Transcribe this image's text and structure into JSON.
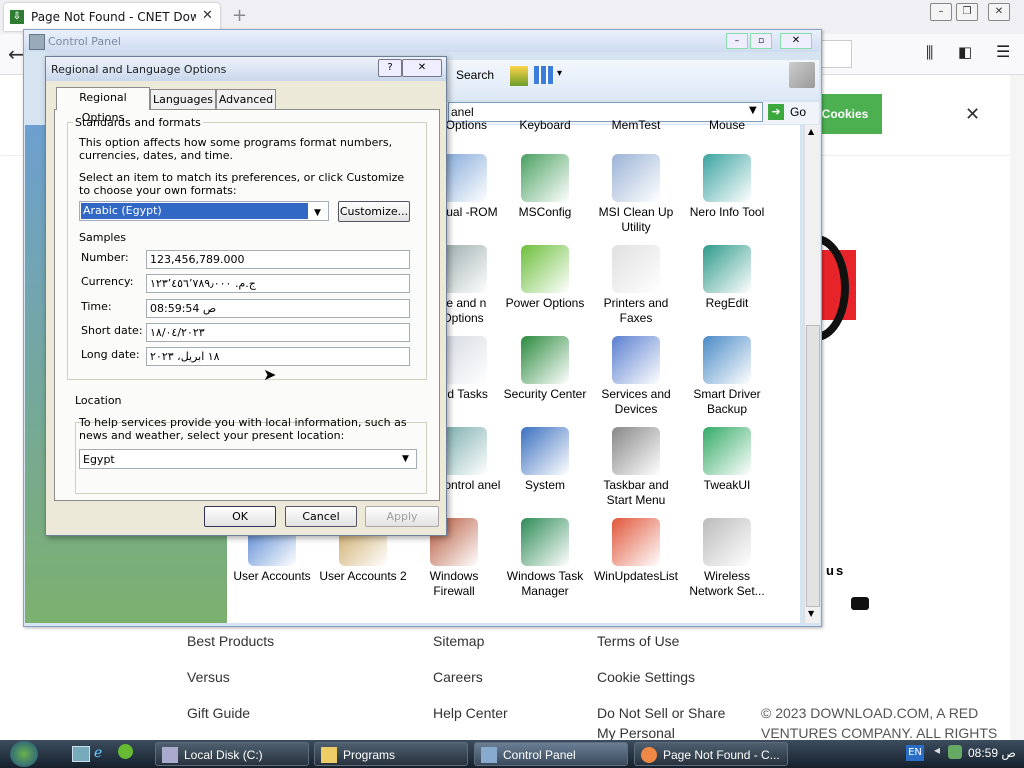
{
  "browser": {
    "tab_title": "Page Not Found - CNET Down",
    "cookies_button": "Cookies",
    "section_text": "us"
  },
  "footer": {
    "col1": [
      "Best Products",
      "Versus",
      "Gift Guide"
    ],
    "col2": [
      "Sitemap",
      "Careers",
      "Help Center"
    ],
    "col3": [
      "Terms of Use",
      "Cookie Settings",
      "Do Not Sell or Share",
      "My Personal"
    ],
    "copyright_1": "© 2023 DOWNLOAD.COM, A RED",
    "copyright_2": "VENTURES COMPANY. ALL RIGHTS"
  },
  "control_panel": {
    "title": "Control Panel",
    "search_label": "Search",
    "address_text": "anel",
    "go_label": "Go",
    "items": [
      {
        "label": "t Options",
        "icon": "folder-options-icon"
      },
      {
        "label": "Keyboard",
        "icon": "keyboard-icon"
      },
      {
        "label": "MemTest",
        "icon": "memtest-icon"
      },
      {
        "label": "Mouse",
        "icon": "mouse-icon"
      },
      {
        "label": "Virtual -ROM",
        "icon": "virtual-cdrom-icon"
      },
      {
        "label": "MSConfig",
        "icon": "msconfig-icon"
      },
      {
        "label": "MSI Clean Up Utility",
        "icon": "broom-icon"
      },
      {
        "label": "Nero Info Tool",
        "icon": "nero-info-icon"
      },
      {
        "label": "ne and n Options",
        "icon": "phone-modem-icon"
      },
      {
        "label": "Power Options",
        "icon": "power-options-icon"
      },
      {
        "label": "Printers and Faxes",
        "icon": "printer-icon"
      },
      {
        "label": "RegEdit",
        "icon": "regedit-icon"
      },
      {
        "label": "led Tasks",
        "icon": "scheduled-tasks-icon"
      },
      {
        "label": "Security Center",
        "icon": "security-shield-icon"
      },
      {
        "label": "Services and Devices",
        "icon": "services-icon"
      },
      {
        "label": "Smart Driver Backup",
        "icon": "driver-backup-icon"
      },
      {
        "label": "o Control anel",
        "icon": "control-panel-icon"
      },
      {
        "label": "System",
        "icon": "system-icon"
      },
      {
        "label": "Taskbar and Start Menu",
        "icon": "taskbar-icon"
      },
      {
        "label": "TweakUI",
        "icon": "tweakui-icon"
      },
      {
        "label": "User Accounts",
        "icon": "user-accounts-icon"
      },
      {
        "label": "User Accounts 2",
        "icon": "user-keys-icon"
      },
      {
        "label": "Windows Firewall",
        "icon": "firewall-icon"
      },
      {
        "label": "Windows Task Manager",
        "icon": "task-manager-icon"
      },
      {
        "label": "WinUpdatesList",
        "icon": "windows-flag-icon"
      },
      {
        "label": "Wireless Network Set...",
        "icon": "wireless-icon"
      }
    ]
  },
  "dialog": {
    "title": "Regional and Language Options",
    "tabs": [
      "Regional Options",
      "Languages",
      "Advanced"
    ],
    "standards_group": "Standards and formats",
    "standards_desc": "This option affects how some programs format numbers, currencies, dates, and time.",
    "select_desc": "Select an item to match its preferences, or click Customize to choose your own formats:",
    "format_value": "Arabic (Egypt)",
    "customize_label": "Customize...",
    "samples_label": "Samples",
    "samples": [
      {
        "label": "Number:",
        "value": "123,456,789.000"
      },
      {
        "label": "Currency:",
        "value": "ج.م.‏ ١٢٣٬٤٥٦٬٧٨٩٫٠٠٠"
      },
      {
        "label": "Time:",
        "value": "08:59:54 ص"
      },
      {
        "label": "Short date:",
        "value": "١٨/٠٤/٢٠٢٣"
      },
      {
        "label": "Long date:",
        "value": "١٨ ابريل، ٢٠٢٣"
      }
    ],
    "location_group": "Location",
    "location_desc": "To help services provide you with local information, such as news and weather, select your present location:",
    "location_value": "Egypt",
    "ok_label": "OK",
    "cancel_label": "Cancel",
    "apply_label": "Apply"
  },
  "taskbar": {
    "buttons": [
      "Local Disk (C:)",
      "Programs",
      "Control Panel",
      "Page Not Found - C..."
    ],
    "lang": "EN",
    "clock": "08:59 ص"
  }
}
